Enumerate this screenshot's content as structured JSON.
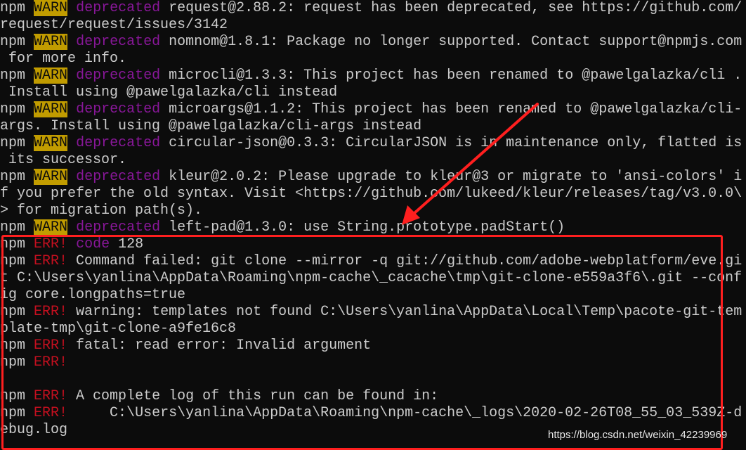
{
  "colors": {
    "background": "#0c0c0c",
    "text": "#cccccc",
    "warn_bg": "#c19c00",
    "err": "#c50f1f",
    "tag": "#881798",
    "annotation": "#ff1f1f"
  },
  "terminal": {
    "lines": [
      {
        "prefix": "npm",
        "level": "WARN",
        "tag": "deprecated",
        "text": " request@2.88.2: request has been deprecated, see https://github.com/"
      },
      {
        "text": "request/request/issues/3142"
      },
      {
        "prefix": "npm",
        "level": "WARN",
        "tag": "deprecated",
        "text": " nomnom@1.8.1: Package no longer supported. Contact support@npmjs.com"
      },
      {
        "text": " for more info."
      },
      {
        "prefix": "npm",
        "level": "WARN",
        "tag": "deprecated",
        "text": " microcli@1.3.3: This project has been renamed to @pawelgalazka/cli ."
      },
      {
        "text": " Install using @pawelgalazka/cli instead"
      },
      {
        "prefix": "npm",
        "level": "WARN",
        "tag": "deprecated",
        "text": " microargs@1.1.2: This project has been renamed to @pawelgalazka/cli-"
      },
      {
        "text": "args. Install using @pawelgalazka/cli-args instead"
      },
      {
        "prefix": "npm",
        "level": "WARN",
        "tag": "deprecated",
        "text": " circular-json@0.3.3: CircularJSON is in maintenance only, flatted is"
      },
      {
        "text": " its successor."
      },
      {
        "prefix": "npm",
        "level": "WARN",
        "tag": "deprecated",
        "text": " kleur@2.0.2: Please upgrade to kleur@3 or migrate to 'ansi-colors' i"
      },
      {
        "text": "f you prefer the old syntax. Visit <https://github.com/lukeed/kleur/releases/tag/v3.0.0\\"
      },
      {
        "text": "> for migration path(s)."
      },
      {
        "prefix": "npm",
        "level": "WARN",
        "tag": "deprecated",
        "text": " left-pad@1.3.0: use String.prototype.padStart()"
      },
      {
        "prefix": "npm",
        "level": "ERR!",
        "tag": "code",
        "text": " 128"
      },
      {
        "prefix": "npm",
        "level": "ERR!",
        "text": " Command failed: git clone --mirror -q git://github.com/adobe-webplatform/eve.gi"
      },
      {
        "text": "t C:\\Users\\yanlina\\AppData\\Roaming\\npm-cache\\_cacache\\tmp\\git-clone-e559a3f6\\.git --conf"
      },
      {
        "text": "ig core.longpaths=true"
      },
      {
        "prefix": "npm",
        "level": "ERR!",
        "text": " warning: templates not found C:\\Users\\yanlina\\AppData\\Local\\Temp\\pacote-git-tem"
      },
      {
        "text": "plate-tmp\\git-clone-a9fe16c8"
      },
      {
        "prefix": "npm",
        "level": "ERR!",
        "text": " fatal: read error: Invalid argument"
      },
      {
        "prefix": "npm",
        "level": "ERR!",
        "text": ""
      },
      {
        "text": ""
      },
      {
        "prefix": "npm",
        "level": "ERR!",
        "text": " A complete log of this run can be found in:"
      },
      {
        "prefix": "npm",
        "level": "ERR!",
        "text": "     C:\\Users\\yanlina\\AppData\\Roaming\\npm-cache\\_logs\\2020-02-26T08_55_03_539Z-d"
      },
      {
        "text": "ebug.log"
      }
    ]
  },
  "watermark": "https://blog.csdn.net/weixin_42239969"
}
